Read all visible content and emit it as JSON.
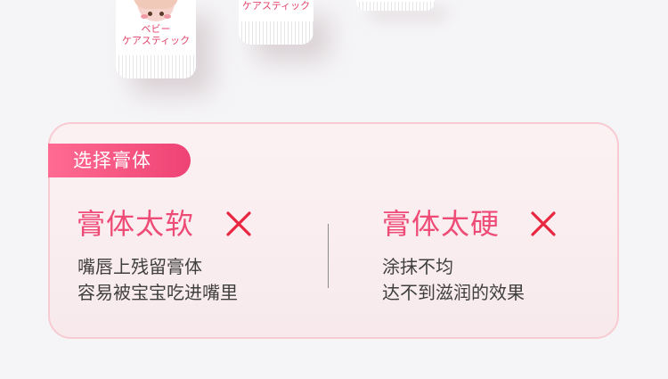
{
  "product": {
    "tube1_line1": "ベビー",
    "tube1_line2": "ケアスティック",
    "tube2_line1": "ケアスティック"
  },
  "card": {
    "tag_label": "选择膏体",
    "left": {
      "title": "膏体太软",
      "line1": "嘴唇上残留膏体",
      "line2": "容易被宝宝吃进嘴里"
    },
    "right": {
      "title": "膏体太硬",
      "line1": "涂抹不均",
      "line2": "达不到滋润的效果"
    }
  },
  "colors": {
    "accent": "#ee4c77",
    "x_mark": "#e8263f",
    "tag_start": "#ff6b93",
    "tag_end": "#ee4374",
    "card_border": "#f8cbd3",
    "card_bg": "#fbf1f3"
  },
  "icons": {
    "left_mark": "cross-icon",
    "right_mark": "cross-icon"
  }
}
